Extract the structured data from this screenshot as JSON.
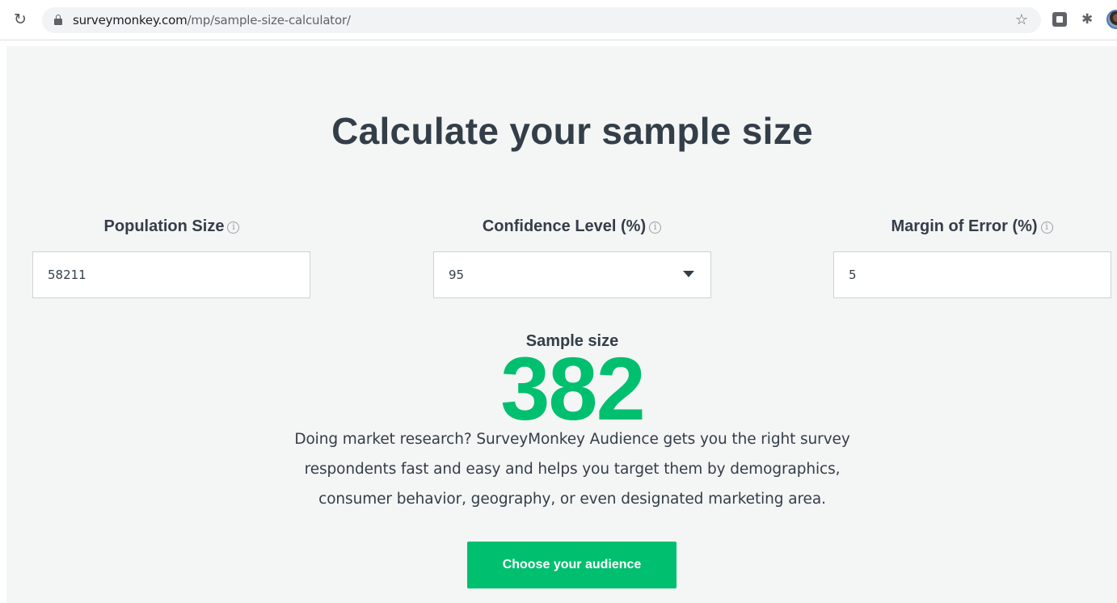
{
  "browser": {
    "url_host": "surveymonkey.com",
    "url_path": "/mp/sample-size-calculator/"
  },
  "icons": {
    "reload": "reload-icon",
    "lock": "lock-icon",
    "bookmark": "star-icon",
    "extension_1": "extension-icon",
    "extensions": "puzzle-icon",
    "profile": "profile-avatar"
  },
  "page": {
    "title": "Calculate your sample size",
    "fields": {
      "population": {
        "label": "Population Size",
        "value": "58211"
      },
      "confidence": {
        "label": "Confidence Level (%)",
        "value": "95"
      },
      "margin": {
        "label": "Margin of Error (%)",
        "value": "5"
      }
    },
    "info_glyph": "i",
    "result": {
      "label": "Sample size",
      "value": "382"
    },
    "promo": {
      "line1": "Doing market research? SurveyMonkey Audience gets you the right survey",
      "line2": "respondents fast and easy and helps you target them by demographics,",
      "line3": "consumer behavior, geography, or even designated marketing area."
    },
    "cta_label": "Choose your audience"
  },
  "colors": {
    "brand_green": "#00bf6f",
    "heading": "#333e48",
    "page_bg": "#f4f5f5"
  }
}
